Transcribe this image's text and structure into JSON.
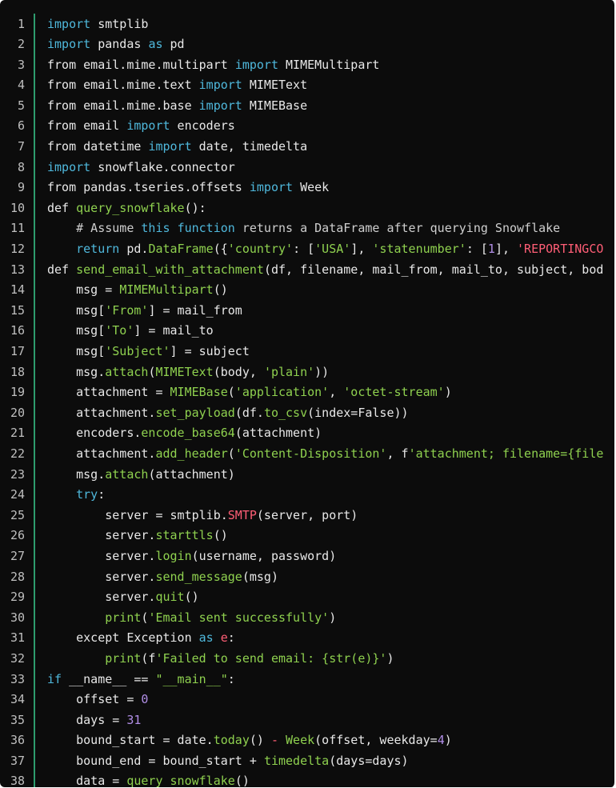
{
  "colors": {
    "background": "#0c0c0c",
    "gutter_text": "#bfbfbf",
    "divider": "#2e9c6e",
    "keyword": "#4fb8dc",
    "function": "#8fd14f",
    "string": "#8fd14f",
    "number": "#b18ee6",
    "error_name": "#ff5e76",
    "text": "#e8e8e8"
  },
  "editor": {
    "lines": [
      [
        {
          "t": "import",
          "k": "kw"
        },
        {
          "t": " smtplib",
          "k": "plain"
        }
      ],
      [
        {
          "t": "import",
          "k": "kw"
        },
        {
          "t": " pandas ",
          "k": "plain"
        },
        {
          "t": "as",
          "k": "kw"
        },
        {
          "t": " pd",
          "k": "plain"
        }
      ],
      [
        {
          "t": "from email.mime.multipart ",
          "k": "plain"
        },
        {
          "t": "import",
          "k": "kw"
        },
        {
          "t": " MIMEMultipart",
          "k": "plain"
        }
      ],
      [
        {
          "t": "from email.mime.text ",
          "k": "plain"
        },
        {
          "t": "import",
          "k": "kw"
        },
        {
          "t": " MIMEText",
          "k": "plain"
        }
      ],
      [
        {
          "t": "from email.mime.base ",
          "k": "plain"
        },
        {
          "t": "import",
          "k": "kw"
        },
        {
          "t": " MIMEBase",
          "k": "plain"
        }
      ],
      [
        {
          "t": "from email ",
          "k": "plain"
        },
        {
          "t": "import",
          "k": "kw"
        },
        {
          "t": " encoders",
          "k": "plain"
        }
      ],
      [
        {
          "t": "from datetime ",
          "k": "plain"
        },
        {
          "t": "import",
          "k": "kw"
        },
        {
          "t": " date, timedelta",
          "k": "plain"
        }
      ],
      [
        {
          "t": "import",
          "k": "kw"
        },
        {
          "t": " snowflake.connector",
          "k": "plain"
        }
      ],
      [
        {
          "t": "from pandas.tseries.offsets ",
          "k": "plain"
        },
        {
          "t": "import",
          "k": "kw"
        },
        {
          "t": " Week",
          "k": "plain"
        }
      ],
      [
        {
          "t": "def ",
          "k": "plain"
        },
        {
          "t": "query_snowflake",
          "k": "fn"
        },
        {
          "t": "():",
          "k": "plain"
        }
      ],
      [
        {
          "t": "    # Assume ",
          "k": "cmt"
        },
        {
          "t": "this",
          "k": "kw"
        },
        {
          "t": " ",
          "k": "cmt"
        },
        {
          "t": "function",
          "k": "kw"
        },
        {
          "t": " returns a DataFrame after querying Snowflake",
          "k": "cmt"
        }
      ],
      [
        {
          "t": "    ",
          "k": "plain"
        },
        {
          "t": "return",
          "k": "kw"
        },
        {
          "t": " pd.",
          "k": "plain"
        },
        {
          "t": "DataFrame",
          "k": "fn"
        },
        {
          "t": "({",
          "k": "plain"
        },
        {
          "t": "'country'",
          "k": "str"
        },
        {
          "t": ": [",
          "k": "plain"
        },
        {
          "t": "'USA'",
          "k": "str"
        },
        {
          "t": "], ",
          "k": "plain"
        },
        {
          "t": "'statenumber'",
          "k": "str"
        },
        {
          "t": ": [",
          "k": "plain"
        },
        {
          "t": "1",
          "k": "num"
        },
        {
          "t": "], ",
          "k": "plain"
        },
        {
          "t": "'REPORTINGCO",
          "k": "exc"
        }
      ],
      [
        {
          "t": "def ",
          "k": "plain"
        },
        {
          "t": "send_email_with_attachment",
          "k": "fn"
        },
        {
          "t": "(df, filename, mail_from, mail_to, subject, bod",
          "k": "plain"
        }
      ],
      [
        {
          "t": "    msg = ",
          "k": "plain"
        },
        {
          "t": "MIMEMultipart",
          "k": "fn"
        },
        {
          "t": "()",
          "k": "plain"
        }
      ],
      [
        {
          "t": "    msg[",
          "k": "plain"
        },
        {
          "t": "'From'",
          "k": "str"
        },
        {
          "t": "] = mail_from",
          "k": "plain"
        }
      ],
      [
        {
          "t": "    msg[",
          "k": "plain"
        },
        {
          "t": "'To'",
          "k": "str"
        },
        {
          "t": "] = mail_to",
          "k": "plain"
        }
      ],
      [
        {
          "t": "    msg[",
          "k": "plain"
        },
        {
          "t": "'Subject'",
          "k": "str"
        },
        {
          "t": "] = subject",
          "k": "plain"
        }
      ],
      [
        {
          "t": "    msg.",
          "k": "plain"
        },
        {
          "t": "attach",
          "k": "fn"
        },
        {
          "t": "(",
          "k": "plain"
        },
        {
          "t": "MIMEText",
          "k": "fn"
        },
        {
          "t": "(body, ",
          "k": "plain"
        },
        {
          "t": "'plain'",
          "k": "str"
        },
        {
          "t": "))",
          "k": "plain"
        }
      ],
      [
        {
          "t": "    attachment = ",
          "k": "plain"
        },
        {
          "t": "MIMEBase",
          "k": "fn"
        },
        {
          "t": "(",
          "k": "plain"
        },
        {
          "t": "'application'",
          "k": "str"
        },
        {
          "t": ", ",
          "k": "plain"
        },
        {
          "t": "'octet-stream'",
          "k": "str"
        },
        {
          "t": ")",
          "k": "plain"
        }
      ],
      [
        {
          "t": "    attachment.",
          "k": "plain"
        },
        {
          "t": "set_payload",
          "k": "fn"
        },
        {
          "t": "(df.",
          "k": "plain"
        },
        {
          "t": "to_csv",
          "k": "fn"
        },
        {
          "t": "(index=False))",
          "k": "plain"
        }
      ],
      [
        {
          "t": "    encoders.",
          "k": "plain"
        },
        {
          "t": "encode_base64",
          "k": "fn"
        },
        {
          "t": "(attachment)",
          "k": "plain"
        }
      ],
      [
        {
          "t": "    attachment.",
          "k": "plain"
        },
        {
          "t": "add_header",
          "k": "fn"
        },
        {
          "t": "(",
          "k": "plain"
        },
        {
          "t": "'Content-Disposition'",
          "k": "str"
        },
        {
          "t": ", f",
          "k": "plain"
        },
        {
          "t": "'attachment; filename={file",
          "k": "str"
        }
      ],
      [
        {
          "t": "    msg.",
          "k": "plain"
        },
        {
          "t": "attach",
          "k": "fn"
        },
        {
          "t": "(attachment)",
          "k": "plain"
        }
      ],
      [
        {
          "t": "    ",
          "k": "plain"
        },
        {
          "t": "try",
          "k": "kw"
        },
        {
          "t": ":",
          "k": "plain"
        }
      ],
      [
        {
          "t": "        server = smtplib.",
          "k": "plain"
        },
        {
          "t": "SMTP",
          "k": "exc"
        },
        {
          "t": "(server, port)",
          "k": "plain"
        }
      ],
      [
        {
          "t": "        server.",
          "k": "plain"
        },
        {
          "t": "starttls",
          "k": "fn"
        },
        {
          "t": "()",
          "k": "plain"
        }
      ],
      [
        {
          "t": "        server.",
          "k": "plain"
        },
        {
          "t": "login",
          "k": "fn"
        },
        {
          "t": "(username, password)",
          "k": "plain"
        }
      ],
      [
        {
          "t": "        server.",
          "k": "plain"
        },
        {
          "t": "send_message",
          "k": "fn"
        },
        {
          "t": "(msg)",
          "k": "plain"
        }
      ],
      [
        {
          "t": "        server.",
          "k": "plain"
        },
        {
          "t": "quit",
          "k": "fn"
        },
        {
          "t": "()",
          "k": "plain"
        }
      ],
      [
        {
          "t": "        ",
          "k": "plain"
        },
        {
          "t": "print",
          "k": "fn"
        },
        {
          "t": "(",
          "k": "plain"
        },
        {
          "t": "'Email sent successfully'",
          "k": "str"
        },
        {
          "t": ")",
          "k": "plain"
        }
      ],
      [
        {
          "t": "    except Exception ",
          "k": "plain"
        },
        {
          "t": "as",
          "k": "kw"
        },
        {
          "t": " ",
          "k": "plain"
        },
        {
          "t": "e",
          "k": "exc"
        },
        {
          "t": ":",
          "k": "plain"
        }
      ],
      [
        {
          "t": "        ",
          "k": "plain"
        },
        {
          "t": "print",
          "k": "fn"
        },
        {
          "t": "(f",
          "k": "plain"
        },
        {
          "t": "'Failed to send email: {str(e)}'",
          "k": "str"
        },
        {
          "t": ")",
          "k": "plain"
        }
      ],
      [
        {
          "t": "if",
          "k": "kw"
        },
        {
          "t": " __name__ == ",
          "k": "plain"
        },
        {
          "t": "\"__main__\"",
          "k": "str"
        },
        {
          "t": ":",
          "k": "plain"
        }
      ],
      [
        {
          "t": "    offset = ",
          "k": "plain"
        },
        {
          "t": "0",
          "k": "num"
        }
      ],
      [
        {
          "t": "    days = ",
          "k": "plain"
        },
        {
          "t": "31",
          "k": "num"
        }
      ],
      [
        {
          "t": "    bound_start = date.",
          "k": "plain"
        },
        {
          "t": "today",
          "k": "fn"
        },
        {
          "t": "() ",
          "k": "plain"
        },
        {
          "t": "-",
          "k": "exc"
        },
        {
          "t": " ",
          "k": "plain"
        },
        {
          "t": "Week",
          "k": "fn"
        },
        {
          "t": "(offset, weekday=",
          "k": "plain"
        },
        {
          "t": "4",
          "k": "num"
        },
        {
          "t": ")",
          "k": "plain"
        }
      ],
      [
        {
          "t": "    bound_end = bound_start + ",
          "k": "plain"
        },
        {
          "t": "timedelta",
          "k": "fn"
        },
        {
          "t": "(days=days)",
          "k": "plain"
        }
      ],
      [
        {
          "t": "    data = ",
          "k": "plain"
        },
        {
          "t": "query_snowflake",
          "k": "fn"
        },
        {
          "t": "()",
          "k": "plain"
        }
      ]
    ]
  }
}
